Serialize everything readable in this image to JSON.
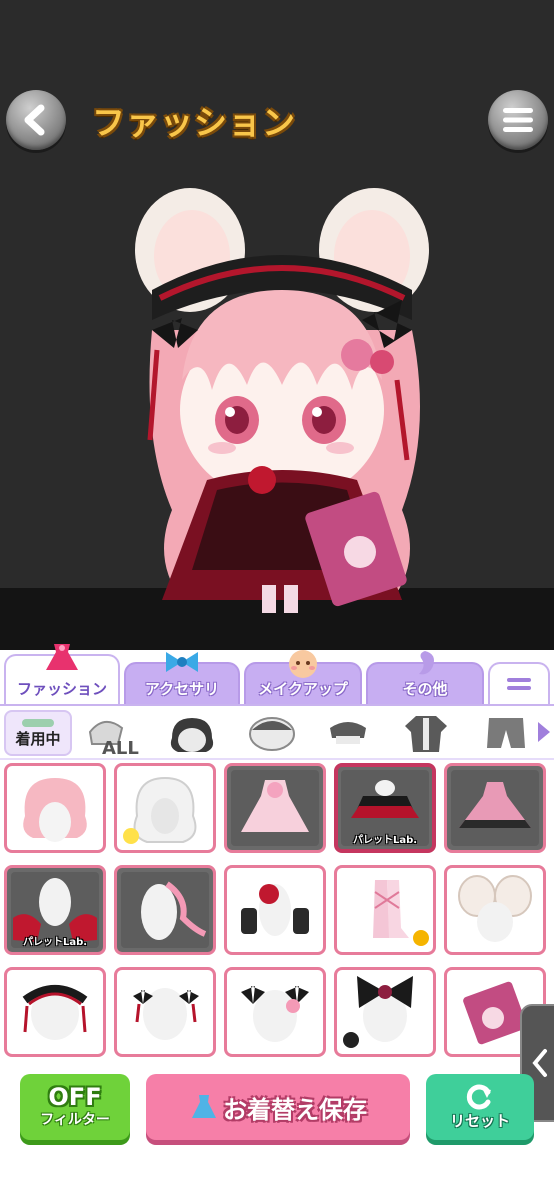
{
  "header": {
    "title": "ファッション"
  },
  "tabs": [
    {
      "label": "ファッション",
      "icon": "dress-icon",
      "active": true
    },
    {
      "label": "アクセサリ",
      "icon": "bow-icon",
      "active": false
    },
    {
      "label": "メイクアップ",
      "icon": "face-icon",
      "active": false
    },
    {
      "label": "その他",
      "icon": "misc-icon",
      "active": false
    }
  ],
  "categories": {
    "equipped_label": "着用中",
    "items": [
      "ALL",
      "hair",
      "face-mask",
      "headwear",
      "top",
      "jacket",
      "bottom"
    ]
  },
  "items": [
    {
      "name": "pink-bob-hair",
      "tag": ""
    },
    {
      "name": "white-wavy-hair",
      "tag": ""
    },
    {
      "name": "pink-frill-dress",
      "tag": ""
    },
    {
      "name": "black-red-skirt",
      "tag": "パレットLab."
    },
    {
      "name": "pink-gothic-dress",
      "tag": ""
    },
    {
      "name": "red-frill-skirt",
      "tag": "パレットLab."
    },
    {
      "name": "pink-ribbon-tail",
      "tag": ""
    },
    {
      "name": "strawberry-gloves",
      "tag": ""
    },
    {
      "name": "pink-lace-boots",
      "tag": ""
    },
    {
      "name": "mouse-ears",
      "tag": ""
    },
    {
      "name": "black-frill-headdress",
      "tag": ""
    },
    {
      "name": "black-ribbon-hairclips",
      "tag": ""
    },
    {
      "name": "pink-ribbon-hairclips",
      "tag": ""
    },
    {
      "name": "black-big-bow",
      "tag": ""
    },
    {
      "name": "pink-book",
      "tag": ""
    }
  ],
  "actions": {
    "filter_state": "OFF",
    "filter_label": "フィルター",
    "save_label": "お着替え保存",
    "reset_label": "リセット"
  },
  "colors": {
    "accent": "#f67fa8",
    "item_border": "#e77b9a",
    "tab_inactive": "#c7aef2",
    "title": "#f9c64a"
  }
}
